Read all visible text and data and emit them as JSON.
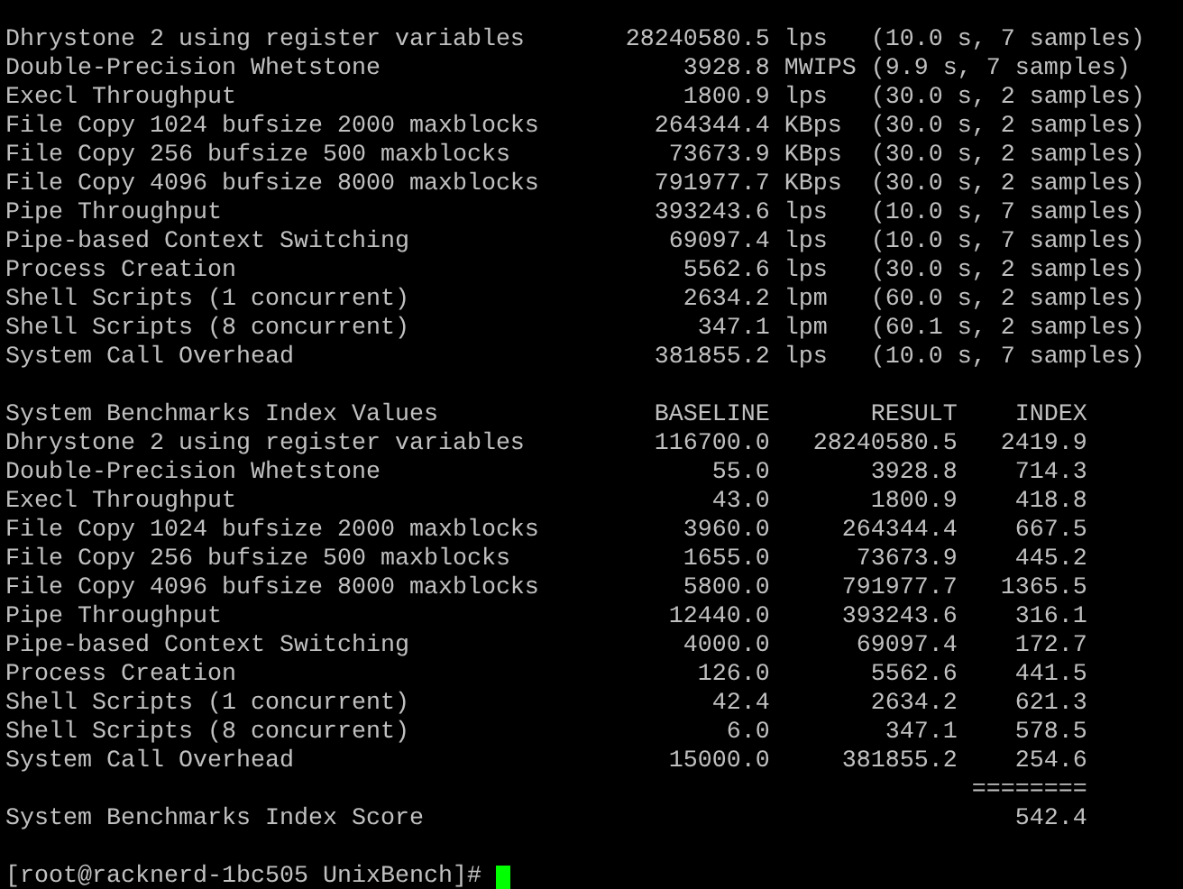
{
  "results": [
    {
      "name": "Dhrystone 2 using register variables",
      "value": "28240580.5",
      "unit": "lps",
      "detail": "(10.0 s, 7 samples)"
    },
    {
      "name": "Double-Precision Whetstone",
      "value": "3928.8",
      "unit": "MWIPS",
      "detail": "(9.9 s, 7 samples)"
    },
    {
      "name": "Execl Throughput",
      "value": "1800.9",
      "unit": "lps",
      "detail": "(30.0 s, 2 samples)"
    },
    {
      "name": "File Copy 1024 bufsize 2000 maxblocks",
      "value": "264344.4",
      "unit": "KBps",
      "detail": "(30.0 s, 2 samples)"
    },
    {
      "name": "File Copy 256 bufsize 500 maxblocks",
      "value": "73673.9",
      "unit": "KBps",
      "detail": "(30.0 s, 2 samples)"
    },
    {
      "name": "File Copy 4096 bufsize 8000 maxblocks",
      "value": "791977.7",
      "unit": "KBps",
      "detail": "(30.0 s, 2 samples)"
    },
    {
      "name": "Pipe Throughput",
      "value": "393243.6",
      "unit": "lps",
      "detail": "(10.0 s, 7 samples)"
    },
    {
      "name": "Pipe-based Context Switching",
      "value": "69097.4",
      "unit": "lps",
      "detail": "(10.0 s, 7 samples)"
    },
    {
      "name": "Process Creation",
      "value": "5562.6",
      "unit": "lps",
      "detail": "(30.0 s, 2 samples)"
    },
    {
      "name": "Shell Scripts (1 concurrent)",
      "value": "2634.2",
      "unit": "lpm",
      "detail": "(60.0 s, 2 samples)"
    },
    {
      "name": "Shell Scripts (8 concurrent)",
      "value": "347.1",
      "unit": "lpm",
      "detail": "(60.1 s, 2 samples)"
    },
    {
      "name": "System Call Overhead",
      "value": "381855.2",
      "unit": "lps",
      "detail": "(10.0 s, 7 samples)"
    }
  ],
  "index_table": {
    "title": "System Benchmarks Index Values",
    "columns": [
      "BASELINE",
      "RESULT",
      "INDEX"
    ],
    "rows": [
      {
        "name": "Dhrystone 2 using register variables",
        "baseline": "116700.0",
        "result": "28240580.5",
        "index": "2419.9"
      },
      {
        "name": "Double-Precision Whetstone",
        "baseline": "55.0",
        "result": "3928.8",
        "index": "714.3"
      },
      {
        "name": "Execl Throughput",
        "baseline": "43.0",
        "result": "1800.9",
        "index": "418.8"
      },
      {
        "name": "File Copy 1024 bufsize 2000 maxblocks",
        "baseline": "3960.0",
        "result": "264344.4",
        "index": "667.5"
      },
      {
        "name": "File Copy 256 bufsize 500 maxblocks",
        "baseline": "1655.0",
        "result": "73673.9",
        "index": "445.2"
      },
      {
        "name": "File Copy 4096 bufsize 8000 maxblocks",
        "baseline": "5800.0",
        "result": "791977.7",
        "index": "1365.5"
      },
      {
        "name": "Pipe Throughput",
        "baseline": "12440.0",
        "result": "393243.6",
        "index": "316.1"
      },
      {
        "name": "Pipe-based Context Switching",
        "baseline": "4000.0",
        "result": "69097.4",
        "index": "172.7"
      },
      {
        "name": "Process Creation",
        "baseline": "126.0",
        "result": "5562.6",
        "index": "441.5"
      },
      {
        "name": "Shell Scripts (1 concurrent)",
        "baseline": "42.4",
        "result": "2634.2",
        "index": "621.3"
      },
      {
        "name": "Shell Scripts (8 concurrent)",
        "baseline": "6.0",
        "result": "347.1",
        "index": "578.5"
      },
      {
        "name": "System Call Overhead",
        "baseline": "15000.0",
        "result": "381855.2",
        "index": "254.6"
      }
    ],
    "separator": "========",
    "score": {
      "label": "System Benchmarks Index Score",
      "value": "542.4"
    }
  },
  "prompt": "[root@racknerd-1bc505 UnixBench]#"
}
